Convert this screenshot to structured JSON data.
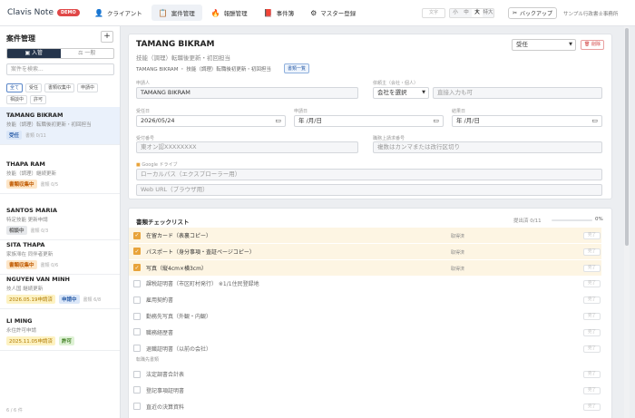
{
  "app": {
    "title": "Clavis Note",
    "badge": "DEMO"
  },
  "nav": [
    {
      "label": "クライアント",
      "icon": "person-icon",
      "glyph": "👤",
      "active": false
    },
    {
      "label": "案件管理",
      "icon": "clipboard-icon",
      "glyph": "📋",
      "active": true
    },
    {
      "label": "報酬管理",
      "icon": "fire-icon",
      "glyph": "🔥",
      "active": false
    },
    {
      "label": "事件簿",
      "icon": "book-icon",
      "glyph": "📕",
      "active": false
    },
    {
      "label": "マスター登録",
      "icon": "gear-icon",
      "glyph": "⚙",
      "active": false
    }
  ],
  "toolbar": {
    "font_label": "文字",
    "sizes": [
      "小",
      "中",
      "大",
      "特大"
    ],
    "selected_size": "大",
    "backup_label": "バックアップ",
    "backup_icon": "✂",
    "office": "サンプル行政書士事務所"
  },
  "sidebar": {
    "title": "案件管理",
    "add_button": "+",
    "segments": [
      "入管",
      "一般"
    ],
    "segment_icons": [
      "▣",
      "⚖"
    ],
    "search_placeholder": "案件を検索...",
    "filters": [
      "全て",
      "受任",
      "書類収集中",
      "申請中",
      "相談中",
      "許可"
    ],
    "cases": [
      {
        "name": "TAMANG BIKRAM",
        "sub": "技能（調理）転職後初更新・初回担当",
        "badge": "受任",
        "badge_class": "b-blue",
        "meta": "書類 0/11",
        "selected": true
      },
      {
        "name": "THAPA RAM",
        "sub": "技能（調理）継続更新",
        "badge": "書類収集中",
        "badge_class": "b-orange",
        "meta": "書類 0/5",
        "selected": false
      },
      {
        "name": "SANTOS MARIA",
        "sub": "特定技能 更新申請",
        "badge": "相談中",
        "badge_class": "b-gray",
        "meta": "書類 0/3",
        "selected": false
      },
      {
        "name": "SITA THAPA",
        "sub": "家族滞在 同伴者更新",
        "badge": "書類収集中",
        "badge_class": "b-orange",
        "meta": "書類 0/6",
        "selected": false
      },
      {
        "name": "NGUYEN VAN MINH",
        "sub": "技人国 継続更新",
        "date": "2026.05.19申請済",
        "badge": "申請中",
        "badge_class": "b-blue",
        "meta": "書類 6/8",
        "selected": false
      },
      {
        "name": "LI MING",
        "sub": "永住許可申請",
        "date": "2025.11.05申請済",
        "badge": "許可",
        "badge_class": "b-green",
        "meta": "",
        "selected": false
      }
    ],
    "footer": "6 / 6 件"
  },
  "detail": {
    "name": "TAMANG BIKRAM",
    "subtitle": "技能（調理）転職後更新・初回担当",
    "breadcrumb": "TAMANG BIKRAM ・ 技能（調理）転職後初更新・初回担当",
    "docs_link": "書類一覧",
    "status": "受任",
    "delete_label": "🗑 削除",
    "applicant_label": "申請人",
    "applicant": "TAMANG BIKRAM",
    "requester_label": "依頼主（会社・個人）",
    "company_select": "会社を選択",
    "requester_placeholder": "直接入力も可",
    "accepted_label": "受任日",
    "accepted": "2026/05/24",
    "applied_label": "申請日",
    "applied": "年 /月/日",
    "result_label": "結果日",
    "result": "年 /月/日",
    "receipt_label": "受付番号",
    "receipt_placeholder": "東オン認XXXXXXXX",
    "reply_label": "職務上請求番号",
    "reply_placeholder": "複数はカンマまたは改行区切り",
    "drive_label": "Google ドライブ",
    "local_placeholder": "ローカルパス（エクスプローラー用）",
    "web_placeholder": "Web URL（ブラウザ用）"
  },
  "checklist": {
    "title": "書類チェックリスト",
    "progress_text": "提出済 0/11",
    "percent": "0%",
    "progress_fraction": 0,
    "items": [
      {
        "label": "在留カード（表裏コピー）",
        "checked": true,
        "status": "取得済",
        "mini": "完了"
      },
      {
        "label": "パスポート（身分事項・査証ページコピー）",
        "checked": true,
        "status": "取得済",
        "mini": "完了"
      },
      {
        "label": "写真（縦4cm×横3cm）",
        "checked": true,
        "status": "取得済",
        "mini": "完了"
      },
      {
        "label": "課税証明書（市区町村発行） ※1/1住民登録地",
        "checked": false,
        "status": "",
        "mini": "完了"
      },
      {
        "label": "雇用契約書",
        "checked": false,
        "status": "",
        "mini": "完了"
      },
      {
        "label": "勤務先写真（外観・内観）",
        "checked": false,
        "status": "",
        "mini": "完了"
      },
      {
        "label": "職務経歴書",
        "checked": false,
        "status": "",
        "mini": "完了"
      },
      {
        "label": "退職証明書（以前の会社）",
        "checked": false,
        "status": "",
        "mini": "完了"
      }
    ],
    "section2": "転職先書類",
    "items2": [
      {
        "label": "法定調書合計表",
        "checked": false,
        "mini": "完了"
      },
      {
        "label": "登記事項証明書",
        "checked": false,
        "mini": "完了"
      },
      {
        "label": "直近の決算資料",
        "checked": false,
        "mini": "完了"
      }
    ]
  }
}
